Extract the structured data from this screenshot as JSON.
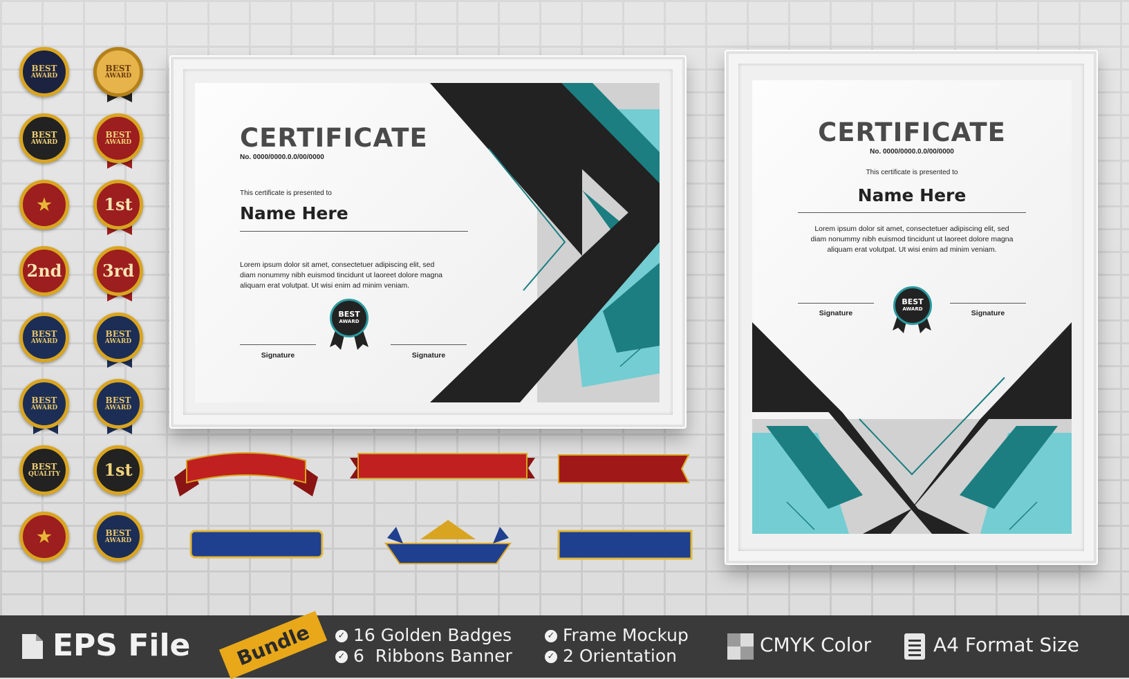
{
  "certificate_landscape": {
    "title": "CERTIFICATE",
    "number": "No. 0000/0000.0.0/00/0000",
    "presented": "This certificate is presented to",
    "name": "Name Here",
    "body_line1": "Lorem ipsum dolor sit amet, consectetuer adipiscing elit, sed",
    "body_line2": "diam nonummy nibh euismod tincidunt ut laoreet dolore magna",
    "body_line3": "aliquam erat volutpat. Ut wisi enim ad minim veniam.",
    "signature_left": "Signature",
    "signature_right": "Signature",
    "seal_top": "BEST",
    "seal_bottom": "AWARD"
  },
  "certificate_portrait": {
    "title": "CERTIFICATE",
    "number": "No. 0000/0000.0.0/00/0000",
    "presented": "This certificate is presented to",
    "name": "Name Here",
    "body_line1": "Lorem ipsum dolor sit amet, consectetuer adipiscing elit, sed",
    "body_line2": "diam nonummy nibh euismod tincidunt ut laoreet dolore magna",
    "body_line3": "aliquam erat volutpat. Ut wisi enim ad minim veniam.",
    "signature_left": "Signature",
    "signature_right": "Signature",
    "seal_top": "BEST",
    "seal_bottom": "AWARD"
  },
  "badges": [
    {
      "top": "BEST",
      "bottom": "AWARD"
    },
    {
      "top": "BEST",
      "bottom": "AWARD"
    },
    {
      "top": "BEST",
      "bottom": "AWARD"
    },
    {
      "top": "BEST",
      "bottom": "AWARD"
    },
    {
      "top": "★",
      "bottom": ""
    },
    {
      "top": "1st",
      "bottom": ""
    },
    {
      "top": "2nd",
      "bottom": ""
    },
    {
      "top": "3rd",
      "bottom": ""
    },
    {
      "top": "BEST",
      "bottom": "AWARD"
    },
    {
      "top": "BEST",
      "bottom": "AWARD"
    },
    {
      "top": "BEST",
      "bottom": "AWARD"
    },
    {
      "top": "BEST",
      "bottom": "AWARD"
    },
    {
      "top": "BEST",
      "bottom": "QUALITY"
    },
    {
      "top": "1st",
      "bottom": ""
    },
    {
      "top": "★",
      "bottom": ""
    },
    {
      "top": "BEST",
      "bottom": "AWARD"
    }
  ],
  "footer": {
    "file_label": "EPS File",
    "bundle_label": "Bundle",
    "feature1": "16 Golden Badges",
    "feature2": "6  Ribbons Banner",
    "feature3": "Frame Mockup",
    "feature4": "2 Orientation",
    "feature5": "CMYK Color",
    "feature6": "A4 Format Size"
  },
  "colors": {
    "teal": "#1c7e80",
    "light_teal": "#73cdd2",
    "dark": "#222222",
    "gold": "#d9a521",
    "red_ribbon": "#b42020",
    "blue_ribbon": "#1f3f8f",
    "footer_bg": "#3a3a3a"
  }
}
